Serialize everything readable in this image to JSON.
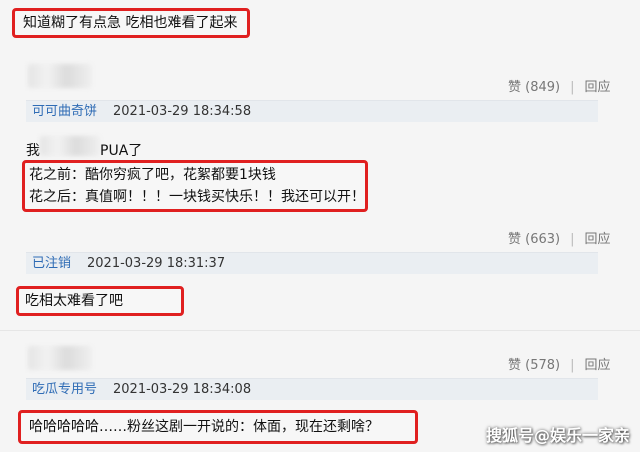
{
  "comments": [
    {
      "headline": "知道糊了有点急 吃相也难看了起来",
      "likes": "赞 (849)",
      "reply": "回应",
      "user": "可可曲奇饼",
      "time": "2021-03-29 18:34:58"
    },
    {
      "prefix_visible": "我",
      "prefix_suffix": "PUA了",
      "line1": "花之前：酷你穷疯了吧，花絮都要1块钱",
      "line2": "花之后：真值啊！！！一块钱买快乐！！我还可以开！",
      "likes": "赞 (663)",
      "reply": "回应",
      "user": "已注销",
      "time": "2021-03-29 18:31:37"
    },
    {
      "body": "吃相太难看了吧",
      "likes": "赞 (578)",
      "reply": "回应",
      "user": "吃瓜专用号",
      "time": "2021-03-29 18:34:08"
    },
    {
      "body": "哈哈哈哈哈……粉丝这剧一开说的：体面，现在还剩啥？"
    }
  ],
  "watermark": "搜狐号@娱乐一家亲",
  "colors": {
    "highlight_border": "#e02020",
    "username": "#2f6cb5",
    "meta_bar": "#eaeef2"
  }
}
